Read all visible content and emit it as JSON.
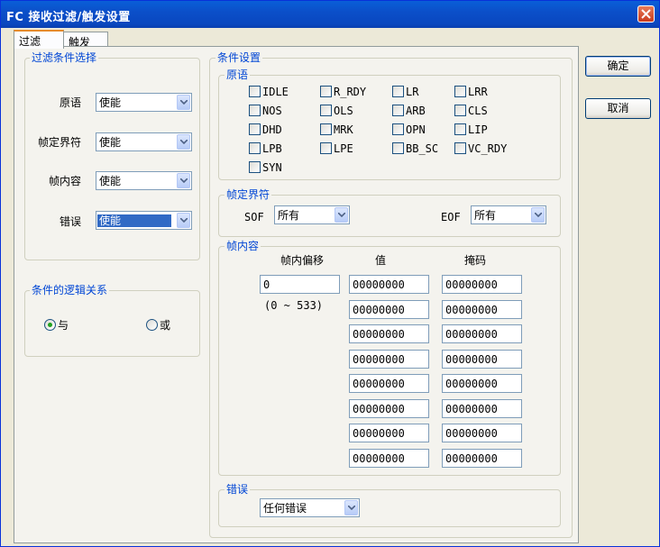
{
  "window": {
    "title": "FC 接收过滤/触发设置"
  },
  "tabs": [
    {
      "label": "过滤"
    },
    {
      "label": "触发"
    }
  ],
  "buttons": {
    "ok": "确定",
    "cancel": "取消"
  },
  "filter_select": {
    "title": "过滤条件选择",
    "rows": [
      {
        "label": "原语",
        "value": "使能"
      },
      {
        "label": "帧定界符",
        "value": "使能"
      },
      {
        "label": "帧内容",
        "value": "使能"
      },
      {
        "label": "错误",
        "value": "使能"
      }
    ]
  },
  "logic": {
    "title": "条件的逻辑关系",
    "options": [
      {
        "label": "与",
        "checked": true
      },
      {
        "label": "或",
        "checked": false
      }
    ]
  },
  "conditions": {
    "title": "条件设置",
    "primitives": {
      "title": "原语",
      "items": [
        {
          "label": "IDLE",
          "checked": false
        },
        {
          "label": "R_RDY",
          "checked": false
        },
        {
          "label": "LR",
          "checked": false
        },
        {
          "label": "LRR",
          "checked": false
        },
        {
          "label": "NOS",
          "checked": false
        },
        {
          "label": "OLS",
          "checked": false
        },
        {
          "label": "ARB",
          "checked": false
        },
        {
          "label": "CLS",
          "checked": false
        },
        {
          "label": "DHD",
          "checked": false
        },
        {
          "label": "MRK",
          "checked": false
        },
        {
          "label": "OPN",
          "checked": false
        },
        {
          "label": "LIP",
          "checked": false
        },
        {
          "label": "LPB",
          "checked": false
        },
        {
          "label": "LPE",
          "checked": false
        },
        {
          "label": "BB_SC",
          "checked": false
        },
        {
          "label": "VC_RDY",
          "checked": false
        },
        {
          "label": "SYN",
          "checked": false
        }
      ]
    },
    "delimiter": {
      "title": "帧定界符",
      "sof_label": "SOF",
      "sof_value": "所有",
      "eof_label": "EOF",
      "eof_value": "所有"
    },
    "content": {
      "title": "帧内容",
      "col_offset": "帧内偏移",
      "col_value": "值",
      "col_mask": "掩码",
      "offset": "0",
      "range": "(0 ~ 533)",
      "values": [
        "00000000",
        "00000000",
        "00000000",
        "00000000",
        "00000000",
        "00000000",
        "00000000",
        "00000000"
      ],
      "masks": [
        "00000000",
        "00000000",
        "00000000",
        "00000000",
        "00000000",
        "00000000",
        "00000000",
        "00000000"
      ]
    },
    "error": {
      "title": "错误",
      "value": "任何错误"
    }
  }
}
